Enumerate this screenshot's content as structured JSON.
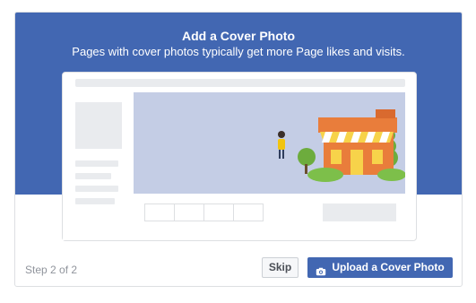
{
  "dialog": {
    "title": "Add a Cover Photo",
    "subtitle": "Pages with cover photos typically get more Page likes and visits."
  },
  "footer": {
    "step_text": "Step 2 of 2",
    "skip_label": "Skip",
    "upload_label": "Upload a Cover Photo",
    "upload_icon": "camera-icon"
  },
  "illustration": {
    "scene": "page-mockup-with-storefront",
    "banner_color": "#4267b2",
    "cover_color": "#c4cde5",
    "storefront_color": "#e97d3b"
  }
}
